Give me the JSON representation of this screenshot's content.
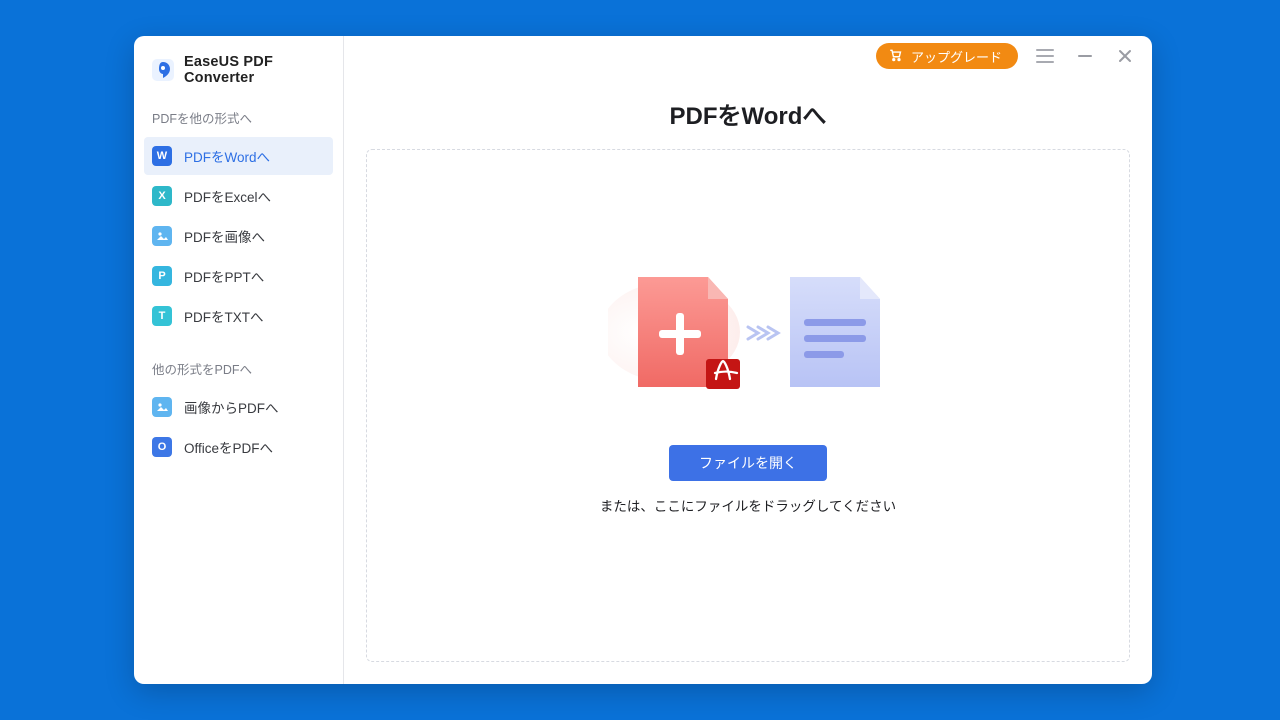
{
  "app": {
    "title": "EaseUS PDF Converter"
  },
  "upgrade": {
    "label": "アップグレード"
  },
  "sidebar": {
    "section1": "PDFを他の形式へ",
    "section2": "他の形式をPDFへ",
    "items1": [
      {
        "label": "PDFをWordへ",
        "name": "sidebar-item-pdf-to-word",
        "iconName": "word-icon",
        "letter": "W",
        "color": "#2d6fe4",
        "selected": true
      },
      {
        "label": "PDFをExcelへ",
        "name": "sidebar-item-pdf-to-excel",
        "iconName": "excel-icon",
        "letter": "X",
        "color": "#2eb8c9",
        "selected": false
      },
      {
        "label": "PDFを画像へ",
        "name": "sidebar-item-pdf-to-image",
        "iconName": "image-icon",
        "letter": "",
        "color": "#5fb5f0",
        "selected": false
      },
      {
        "label": "PDFをPPTへ",
        "name": "sidebar-item-pdf-to-ppt",
        "iconName": "ppt-icon",
        "letter": "P",
        "color": "#35b6df",
        "selected": false
      },
      {
        "label": "PDFをTXTへ",
        "name": "sidebar-item-pdf-to-txt",
        "iconName": "txt-icon",
        "letter": "T",
        "color": "#34c3d6",
        "selected": false
      }
    ],
    "items2": [
      {
        "label": "画像からPDFへ",
        "name": "sidebar-item-image-to-pdf",
        "iconName": "image-icon",
        "letter": "",
        "color": "#5fb5f0",
        "selected": false
      },
      {
        "label": "OfficeをPDFへ",
        "name": "sidebar-item-office-to-pdf",
        "iconName": "office-icon",
        "letter": "O",
        "color": "#3d77e6",
        "selected": false
      }
    ]
  },
  "main": {
    "title": "PDFをWordへ",
    "openButton": "ファイルを開く",
    "dropHint": "または、ここにファイルをドラッグしてください"
  },
  "colors": {
    "accent": "#3d71e6",
    "upgrade": "#f28a12",
    "desktopBg": "#0a72d8"
  }
}
